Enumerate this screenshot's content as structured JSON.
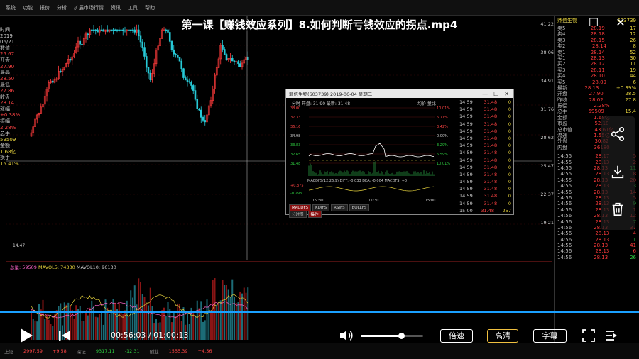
{
  "video": {
    "title": "第一课【赚钱效应系列】8.如何判断亏钱效应的拐点.mp4",
    "current_time": "00:56:03",
    "total_time": "01:00:13",
    "time_separator": "/",
    "progress": 0.93,
    "volume": 0.65,
    "speed_label": "倍速",
    "quality_label": "高清",
    "subtitle_label": "字幕"
  },
  "window_controls": {
    "close": "✕",
    "maximize": "☐",
    "minimize": "—"
  },
  "side_actions": [
    "share-icon",
    "download-icon",
    "delete-icon"
  ],
  "app": {
    "menu": [
      "系统",
      "功能",
      "报价",
      "分析",
      "扩展市场行情",
      "资讯",
      "工具",
      "帮助"
    ],
    "left_labels": [
      {
        "t": "时间",
        "c": "#ccc"
      },
      {
        "t": "2019",
        "c": "#ccc"
      },
      {
        "t": "06/21",
        "c": "#ccc"
      },
      {
        "t": "数值",
        "c": "#ccc"
      },
      {
        "t": "25.67",
        "c": "#ff4444"
      },
      {
        "t": "开盘",
        "c": "#ccc"
      },
      {
        "t": "27.90",
        "c": "#ff4444"
      },
      {
        "t": "最高",
        "c": "#ccc"
      },
      {
        "t": "28.50",
        "c": "#ff4444"
      },
      {
        "t": "最低",
        "c": "#ccc"
      },
      {
        "t": "27.86",
        "c": "#ff4444"
      },
      {
        "t": "收盘",
        "c": "#ccc"
      },
      {
        "t": "28.14",
        "c": "#ff4444"
      },
      {
        "t": "涨幅",
        "c": "#ccc"
      },
      {
        "t": "+0.38%",
        "c": "#ff4444"
      },
      {
        "t": "振幅",
        "c": "#ccc"
      },
      {
        "t": "2.28%",
        "c": "#ff4444"
      },
      {
        "t": "总手",
        "c": "#ccc"
      },
      {
        "t": "59509",
        "c": "#e6d23d"
      },
      {
        "t": "金额",
        "c": "#ccc"
      },
      {
        "t": "1.68亿",
        "c": "#e6d23d"
      },
      {
        "t": "换手",
        "c": "#ccc"
      },
      {
        "t": "15.41%",
        "c": "#e6d23d"
      }
    ],
    "price_axis": [
      "41.22",
      "38.06",
      "34.91",
      "31.76",
      "28.62",
      "25.47",
      "22.37",
      "19.21"
    ],
    "low_marker": "14.47",
    "vol_legend": {
      "vol": "总量: 59509",
      "ma5": "MAVOL5: 74330",
      "ma10": "MAVOL10: 96130"
    },
    "status_items": [
      {
        "t": "上证",
        "c": ""
      },
      {
        "t": "2997.59",
        "c": "up"
      },
      {
        "t": "+9.58",
        "c": "up"
      },
      {
        "t": "深证",
        "c": ""
      },
      {
        "t": "9317.11",
        "c": "dn"
      },
      {
        "t": "-12.31",
        "c": "dn"
      },
      {
        "t": "创业",
        "c": ""
      },
      {
        "t": "1555.39",
        "c": "up"
      },
      {
        "t": "+4.56",
        "c": "up"
      }
    ]
  },
  "right_panel": {
    "stock_name": "鼎信生物",
    "stock_code": "603739",
    "rows": [
      {
        "t": "卖5",
        "p": "28.19",
        "v": "17"
      },
      {
        "t": "卖4",
        "p": "28.18",
        "v": "12"
      },
      {
        "t": "卖3",
        "p": "28.15",
        "v": "26"
      },
      {
        "t": "卖2",
        "p": "28.14",
        "v": "8"
      },
      {
        "t": "卖1",
        "p": "28.14",
        "v": "52"
      },
      {
        "t": "买1",
        "p": "28.13",
        "v": "30"
      },
      {
        "t": "买2",
        "p": "28.12",
        "v": "11"
      },
      {
        "t": "买3",
        "p": "28.11",
        "v": "19"
      },
      {
        "t": "买4",
        "p": "28.10",
        "v": "44"
      },
      {
        "t": "买5",
        "p": "28.09",
        "v": "6"
      },
      {
        "t": "最新",
        "p": "28.13",
        "v": "+0.39%"
      },
      {
        "t": "开盘",
        "p": "27.90",
        "v": "28.5"
      },
      {
        "t": "昨收",
        "p": "28.02",
        "v": "27.8"
      },
      {
        "t": "振幅",
        "p": "2.28%",
        "v": ""
      },
      {
        "t": "总手",
        "p": "59509",
        "v": "15.4"
      },
      {
        "t": "金额",
        "p": "1.68亿",
        "v": ""
      },
      {
        "t": "市盈",
        "p": "52.18",
        "v": ""
      },
      {
        "t": "总市值",
        "p": "43.61亿",
        "v": ""
      },
      {
        "t": "流通",
        "p": "1.55亿",
        "v": ""
      },
      {
        "t": "外盘",
        "p": "30.82",
        "v": ""
      },
      {
        "t": "内盘",
        "p": "36180",
        "v": ""
      }
    ],
    "ticks": [
      {
        "t": "14:55",
        "p": "28.17",
        "v": "5"
      },
      {
        "t": "14:55",
        "p": "28.13",
        "v": "2"
      },
      {
        "t": "14:55",
        "p": "28.13",
        "v": "11"
      },
      {
        "t": "14:55",
        "p": "28.13",
        "v": "8"
      },
      {
        "t": "14:55",
        "p": "28.13",
        "v": "20"
      },
      {
        "t": "14:55",
        "p": "28.13",
        "v": "3"
      },
      {
        "t": "14:56",
        "p": "28.13",
        "v": "14"
      },
      {
        "t": "14:56",
        "p": "28.13",
        "v": "5"
      },
      {
        "t": "14:56",
        "p": "28.13",
        "v": "9"
      },
      {
        "t": "14:56",
        "p": "28.13",
        "v": "1"
      },
      {
        "t": "14:56",
        "p": "28.13",
        "v": "12"
      },
      {
        "t": "14:56",
        "p": "28.13",
        "v": "7"
      },
      {
        "t": "14:56",
        "p": "28.13",
        "v": "37"
      },
      {
        "t": "14:56",
        "p": "28.13",
        "v": "4"
      },
      {
        "t": "14:56",
        "p": "28.13",
        "v": "1"
      },
      {
        "t": "14:56",
        "p": "28.13",
        "v": "41"
      },
      {
        "t": "14:56",
        "p": "28.13",
        "v": "6"
      },
      {
        "t": "14:56",
        "p": "28.13",
        "v": "26"
      }
    ]
  },
  "popup": {
    "title": "鼎信生物(603739) 2019-06-04 星期二",
    "info": "分时  开盘: 31.90  最新: 31.48",
    "info_right": "均价 量比",
    "price_labels": [
      "38.00",
      "37.33",
      "36.16",
      "34.98",
      "33.83",
      "32.65",
      "31.48"
    ],
    "pct_labels": [
      "10.01%",
      "6.71%",
      "3.42%",
      "0.00%",
      "3.29%",
      "6.59%",
      "10.01%"
    ],
    "macd_legend": "MACDFS(12,26,9)  DIFF: -0.033  DEA: -0.004  MACDFS: +0",
    "macd_vals": [
      "+0.375",
      "-0.298"
    ],
    "time_labels": [
      "09:30",
      "11:30",
      "15:00"
    ],
    "tabs": [
      "MACDFS",
      "KDJFS",
      "RSIFS",
      "BOLLFS"
    ],
    "tabs2": [
      "分时图",
      "操作"
    ],
    "trades": [
      {
        "t": "14:59",
        "p": "31.48",
        "v": "0"
      },
      {
        "t": "14:59",
        "p": "31.48",
        "v": "0"
      },
      {
        "t": "14:59",
        "p": "31.48",
        "v": "0"
      },
      {
        "t": "14:59",
        "p": "31.48",
        "v": "0"
      },
      {
        "t": "14:59",
        "p": "31.48",
        "v": "0"
      },
      {
        "t": "14:59",
        "p": "31.48",
        "v": "0"
      },
      {
        "t": "14:59",
        "p": "31.48",
        "v": "0"
      },
      {
        "t": "14:59",
        "p": "31.48",
        "v": "0"
      },
      {
        "t": "14:59",
        "p": "31.48",
        "v": "0"
      },
      {
        "t": "14:59",
        "p": "31.48",
        "v": "0"
      },
      {
        "t": "14:59",
        "p": "31.48",
        "v": "0"
      },
      {
        "t": "14:59",
        "p": "31.48",
        "v": "0"
      },
      {
        "t": "14:59",
        "p": "31.48",
        "v": "0"
      },
      {
        "t": "14:59",
        "p": "31.48",
        "v": "0"
      },
      {
        "t": "14:59",
        "p": "31.48",
        "v": "0"
      },
      {
        "t": "15:00",
        "p": "31.48",
        "v": "257"
      }
    ]
  },
  "colors": {
    "up": "#ff3b3b",
    "down": "#27c9d6",
    "accent": "#1aa0ff",
    "quality_border": "#f0c040"
  }
}
